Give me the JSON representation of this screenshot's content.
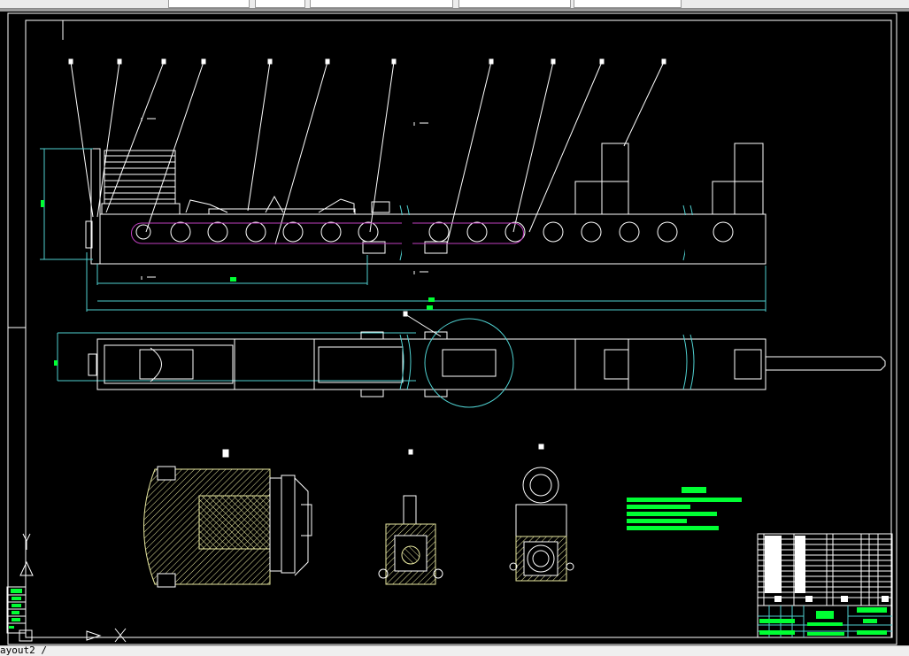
{
  "app": {
    "type": "CAD drawing viewer"
  },
  "colors": {
    "background": "#000000",
    "geometry": "#ffffff",
    "dimension": "#4fd0d0",
    "text": "#00ff33",
    "chain": "#c040c0",
    "hatch": "#e8e8a0"
  },
  "status": {
    "layout_tab": "ayout2 /"
  },
  "icons": [
    "ucs-icon",
    "x-axis-arrow-icon",
    "y-axis-icon"
  ]
}
